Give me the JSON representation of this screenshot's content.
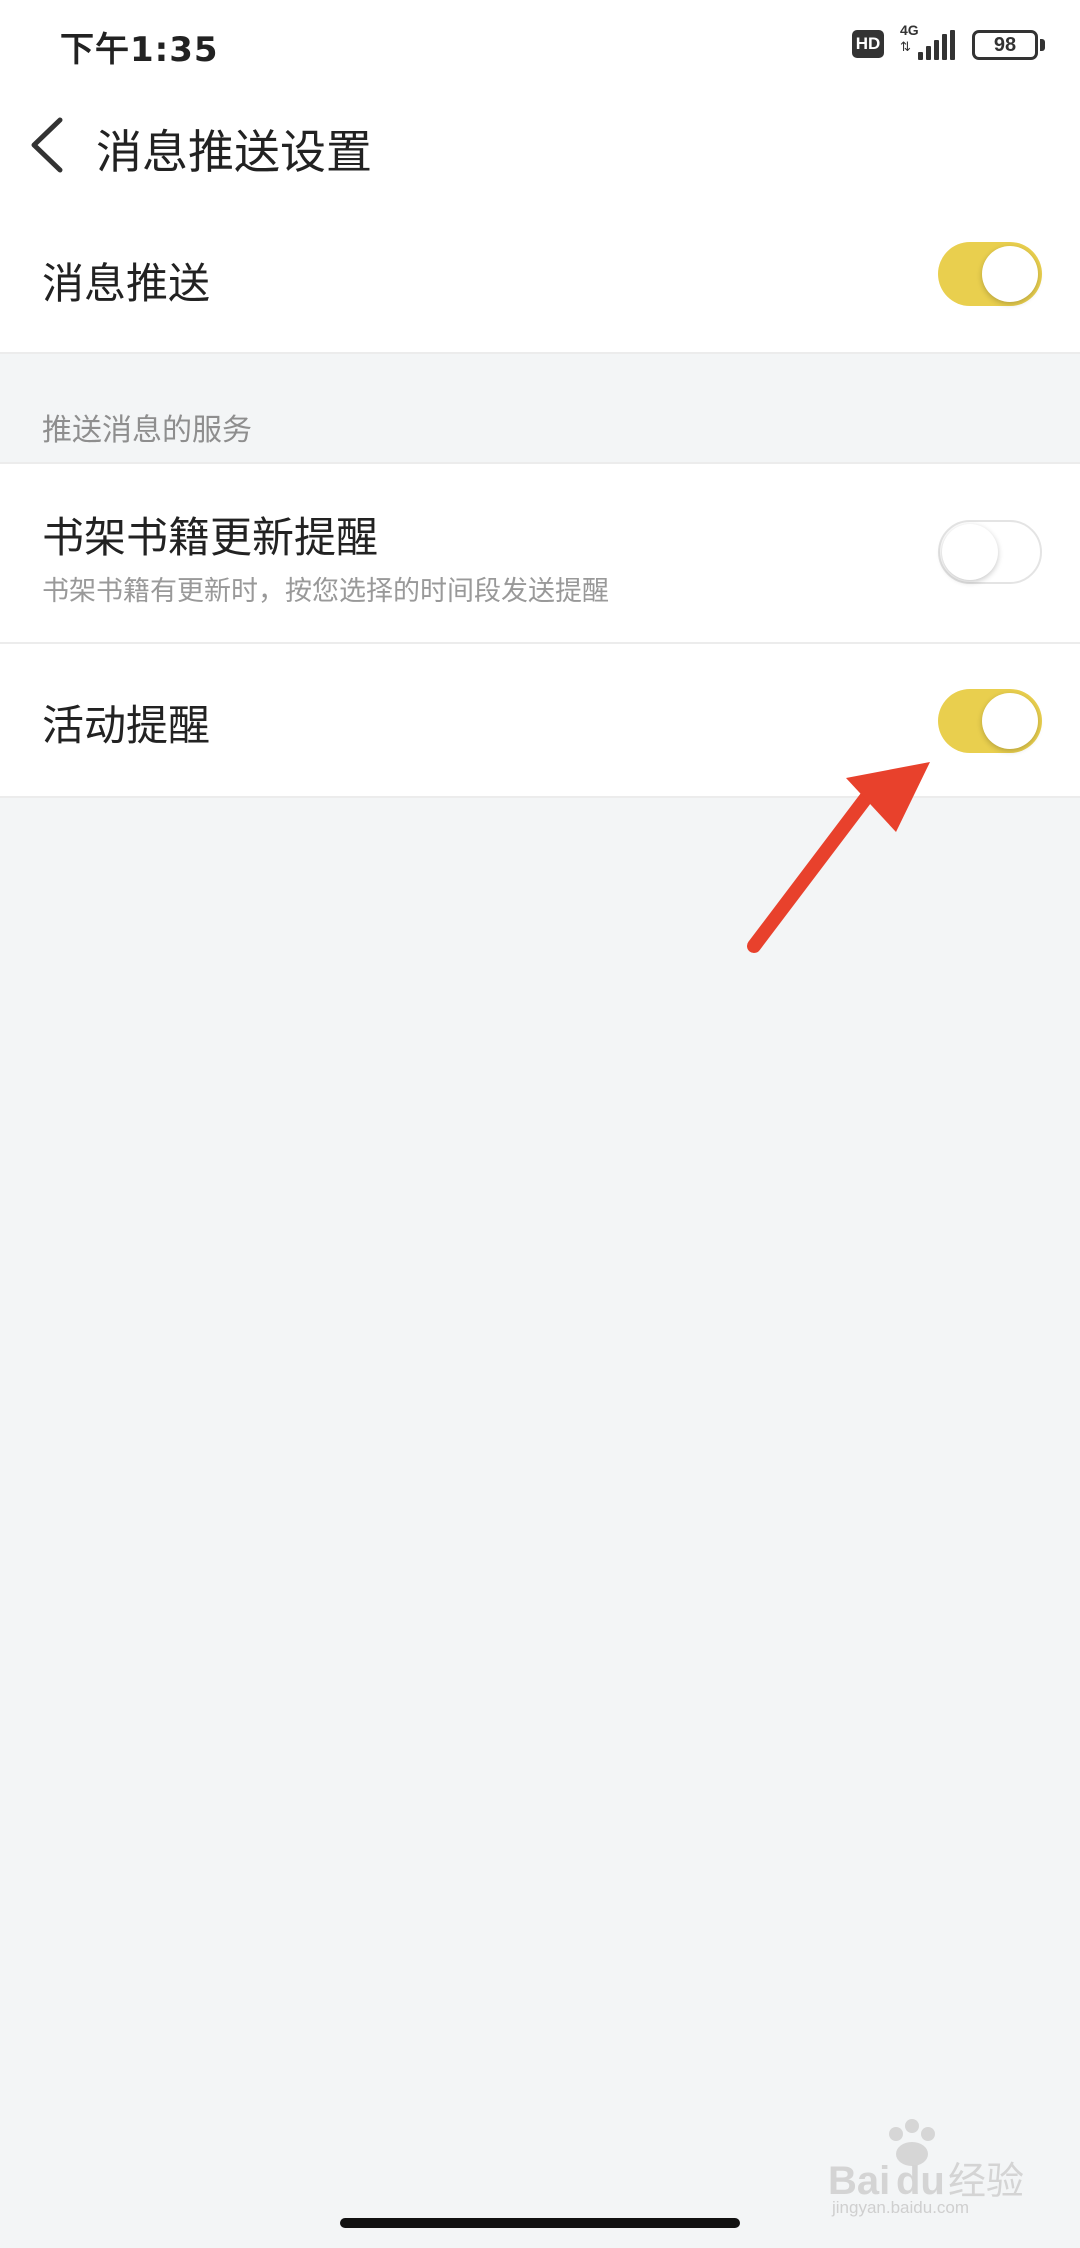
{
  "status_bar": {
    "time": "下午1:35",
    "hd_label": "HD",
    "network_label": "4G",
    "battery_level": "98"
  },
  "header": {
    "title": "消息推送设置",
    "back_icon": "chevron-left-icon"
  },
  "main_toggle": {
    "label": "消息推送",
    "enabled": true
  },
  "section": {
    "label": "推送消息的服务"
  },
  "services": [
    {
      "label": "书架书籍更新提醒",
      "description": "书架书籍有更新时，按您选择的时间段发送提醒",
      "enabled": false
    },
    {
      "label": "活动提醒",
      "enabled": true
    }
  ],
  "colors": {
    "toggle_on": "#e9cf4e",
    "annotation_arrow": "#e8412c",
    "background": "#f3f5f6"
  },
  "watermark": {
    "logo": "Baidu经验",
    "sub": "jingyan.baidu.com"
  }
}
